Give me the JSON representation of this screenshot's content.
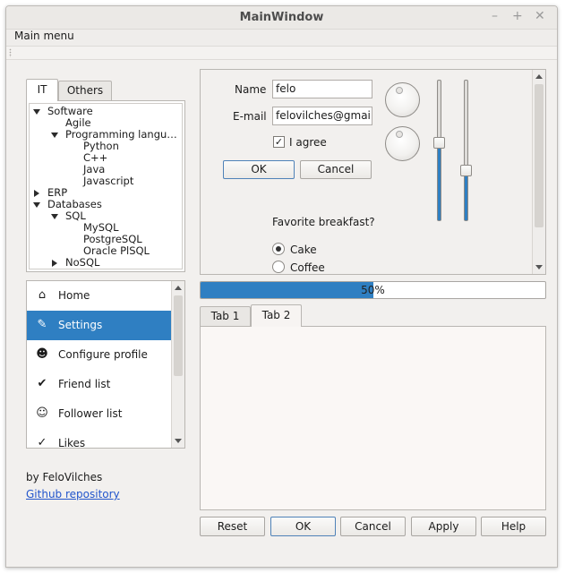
{
  "window": {
    "title": "MainWindow",
    "controls": [
      "–",
      "+",
      "✕"
    ]
  },
  "menubar": {
    "items": [
      "Main menu"
    ]
  },
  "left_tabs": [
    {
      "label": "IT",
      "active": true
    },
    {
      "label": "Others",
      "active": false
    }
  ],
  "tree": [
    {
      "label": "Software",
      "expander": "down"
    },
    {
      "label": "Agile",
      "expander": "none"
    },
    {
      "label": "Programming langu…",
      "expander": "down"
    },
    {
      "label": "Python",
      "expander": "none"
    },
    {
      "label": "C++",
      "expander": "none"
    },
    {
      "label": "Java",
      "expander": "none"
    },
    {
      "label": "Javascript",
      "expander": "none"
    },
    {
      "label": "ERP",
      "expander": "right"
    },
    {
      "label": "Databases",
      "expander": "down"
    },
    {
      "label": "SQL",
      "expander": "down"
    },
    {
      "label": "MySQL",
      "expander": "none"
    },
    {
      "label": "PostgreSQL",
      "expander": "none"
    },
    {
      "label": "Oracle PlSQL",
      "expander": "none"
    },
    {
      "label": "NoSQL",
      "expander": "right"
    }
  ],
  "nav_list": [
    {
      "label": "Home",
      "icon": "home-icon",
      "selected": false
    },
    {
      "label": "Settings",
      "icon": "wrench-icon",
      "selected": true
    },
    {
      "label": "Configure profile",
      "icon": "user-cog-icon",
      "selected": false
    },
    {
      "label": "Friend list",
      "icon": "user-check-icon",
      "selected": false
    },
    {
      "label": "Follower list",
      "icon": "users-icon",
      "selected": false
    },
    {
      "label": "Likes",
      "icon": "double-check-icon",
      "selected": false
    }
  ],
  "credits": {
    "author": "by FeloVilches",
    "link_label": "Github repository"
  },
  "form": {
    "name_label": "Name",
    "name_value": "felo",
    "email_label": "E-mail",
    "email_value": "felovilches@gmail.c",
    "agree_label": "I agree",
    "agree_checked": true,
    "ok_label": "OK",
    "cancel_label": "Cancel",
    "breakfast_label": "Favorite breakfast?",
    "breakfast_options": [
      {
        "label": "Cake",
        "selected": true
      },
      {
        "label": "Coffee",
        "selected": false
      }
    ],
    "slider1_level": 0.55,
    "slider2_level": 0.35
  },
  "progress": {
    "value_text": "50%",
    "value": 0.5
  },
  "right_tabs": [
    {
      "label": "Tab 1",
      "active": false
    },
    {
      "label": "Tab 2",
      "active": true
    }
  ],
  "footer_buttons": [
    "Reset",
    "OK",
    "Cancel",
    "Apply",
    "Help"
  ],
  "colors": {
    "accent": "#2f7fc2",
    "link": "#2255cc",
    "window_bg": "#f2f0ee"
  }
}
